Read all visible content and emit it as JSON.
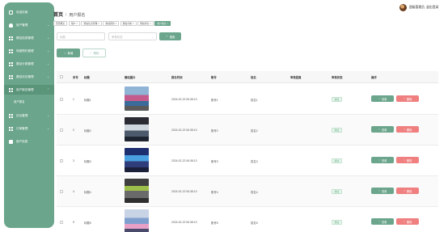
{
  "sidebar": {
    "items": [
      {
        "label": "欢迎页面",
        "icon": "home-icon"
      },
      {
        "label": "用户管理",
        "icon": "person-icon"
      },
      {
        "label": "赛站信息管理",
        "icon": "grid-icon"
      },
      {
        "label": "场馆预约管理",
        "icon": "grid-icon"
      },
      {
        "label": "赛站分类管理",
        "icon": "grid-icon"
      },
      {
        "label": "赛站评论管理",
        "icon": "grid-icon"
      },
      {
        "label": "用户报名管理",
        "icon": "grid-icon"
      },
      {
        "label": "用户报名",
        "icon": ""
      },
      {
        "label": "论坛管理",
        "icon": "grid-icon"
      },
      {
        "label": "订单管理",
        "icon": "grid-icon"
      },
      {
        "label": "用户信息",
        "icon": "box-icon"
      }
    ]
  },
  "header": {
    "breadcrumb_home": "首页",
    "breadcrumb_sep": "/",
    "breadcrumb_current": "用户报名",
    "user_text": "超级管理员, 退出登录"
  },
  "tabs": [
    "首页概览",
    "用户",
    "赛站信息管理",
    "赛站预约",
    "赛站分类",
    "赛站评论",
    "用户报名"
  ],
  "search": {
    "input_placeholder": "标题",
    "select_placeholder": "审核状态",
    "search_label": "搜索"
  },
  "toolbar": {
    "add_label": "新增",
    "delete_label": "删除"
  },
  "table": {
    "headers": [
      "序号",
      "标题",
      "赛站图片",
      "报名时间",
      "账号",
      "姓名",
      "审核回复",
      "审核状态",
      "操作"
    ],
    "rows": [
      {
        "index": "1",
        "title": "标题1",
        "time": "2024-02-22 06:38:13",
        "account": "账号1",
        "name": "姓名1",
        "status": "通过"
      },
      {
        "index": "2",
        "title": "标题2",
        "time": "2024-02-22 06:38:13",
        "account": "账号2",
        "name": "姓名2",
        "status": "通过"
      },
      {
        "index": "3",
        "title": "标题3",
        "time": "2024-02-22 06:38:13",
        "account": "账号3",
        "name": "姓名3",
        "status": "通过"
      },
      {
        "index": "4",
        "title": "标题4",
        "time": "2024-02-22 06:38:13",
        "account": "账号4",
        "name": "姓名4",
        "status": "通过"
      },
      {
        "index": "5",
        "title": "标题5",
        "time": "2024-02-22 06:38:13",
        "account": "账号5",
        "name": "姓名5",
        "status": "通过"
      }
    ],
    "view_label": "查看",
    "remove_label": "删除"
  },
  "colors": {
    "accent": "#6ba58c",
    "danger": "#f08080"
  }
}
